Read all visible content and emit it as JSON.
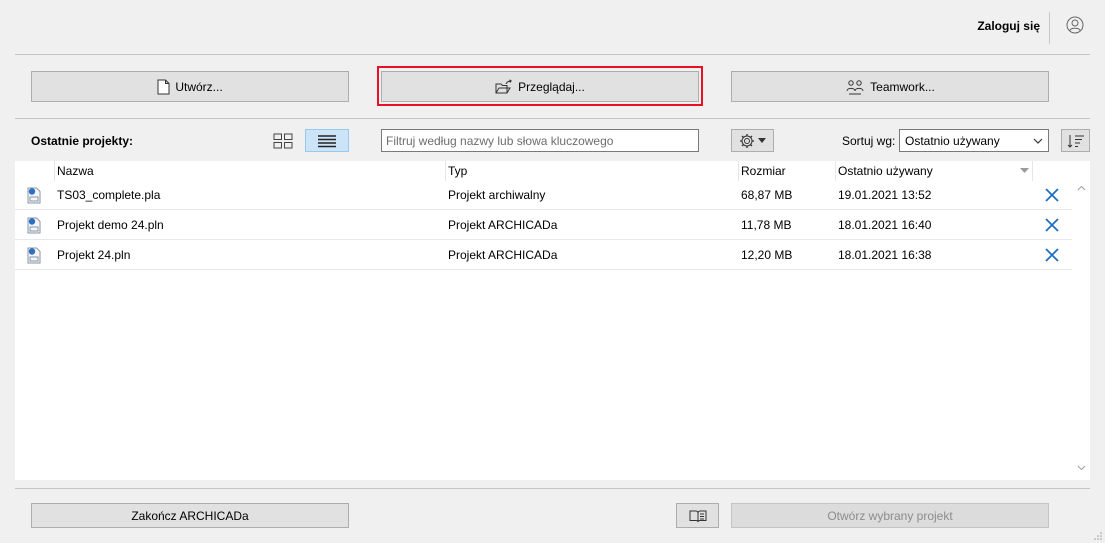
{
  "header": {
    "login_label": "Zaloguj się",
    "user_icon": "user-circle-icon"
  },
  "actions": {
    "create_label": "Utwórz...",
    "browse_label": "Przeglądaj...",
    "teamwork_label": "Teamwork..."
  },
  "toolbar": {
    "recent_label": "Ostatnie projekty:",
    "filter_placeholder": "Filtruj według nazwy lub słowa kluczowego",
    "filter_value": "",
    "sort_label": "Sortuj wg:",
    "sort_value": "Ostatnio używany",
    "active_view": "list"
  },
  "table": {
    "columns": [
      "Nazwa",
      "Typ",
      "Rozmiar",
      "Ostatnio używany"
    ],
    "rows": [
      {
        "name": "TS03_complete.pla",
        "type": "Projekt archiwalny",
        "size": "68,87 MB",
        "date": "19.01.2021 13:52"
      },
      {
        "name": "Projekt demo 24.pln",
        "type": "Projekt ARCHICADa",
        "size": "11,78 MB",
        "date": "18.01.2021 16:40"
      },
      {
        "name": "Projekt 24.pln",
        "type": "Projekt ARCHICADa",
        "size": "12,20 MB",
        "date": "18.01.2021 16:38"
      }
    ]
  },
  "footer": {
    "quit_label": "Zakończ ARCHICADa",
    "open_selected_label": "Otwórz wybrany projekt"
  },
  "colors": {
    "highlight": "#e81123",
    "delete_icon": "#1f6fc5",
    "active_view_bg": "#cce4f7"
  }
}
